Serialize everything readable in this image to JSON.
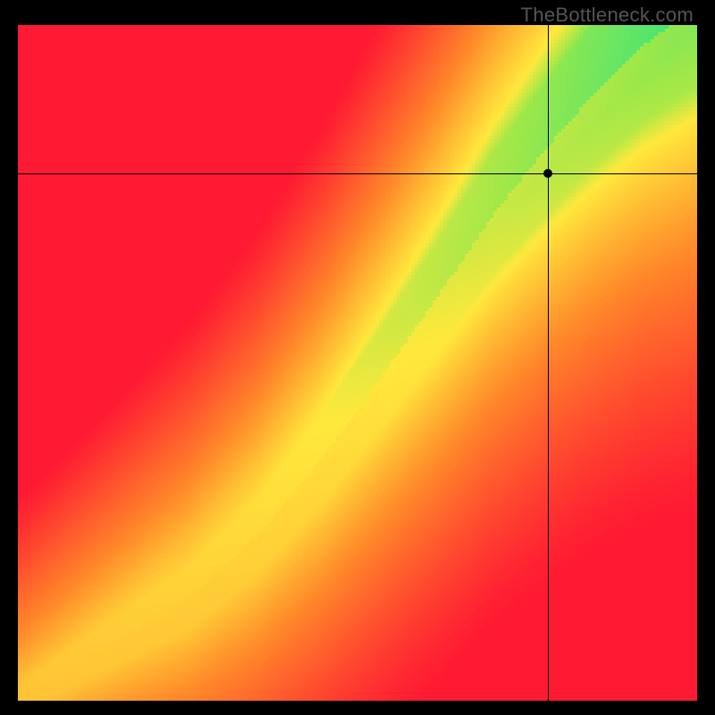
{
  "watermark": "TheBottleneck.com",
  "chart_data": {
    "type": "heatmap",
    "title": "",
    "xlabel": "",
    "ylabel": "",
    "xlim": [
      0,
      100
    ],
    "ylim": [
      0,
      100
    ],
    "crosshair": {
      "x": 78,
      "y": 78
    },
    "marker": {
      "x": 78,
      "y": 78
    },
    "ridge_curve_xy": [
      [
        0,
        0
      ],
      [
        15,
        9
      ],
      [
        25,
        15
      ],
      [
        35,
        24
      ],
      [
        45,
        36
      ],
      [
        55,
        50
      ],
      [
        62,
        60
      ],
      [
        70,
        72
      ],
      [
        78,
        82
      ],
      [
        85,
        90
      ],
      [
        92,
        97
      ],
      [
        100,
        103
      ]
    ],
    "color_scale": {
      "low": "#ff1a33",
      "mid_low": "#ff8a2a",
      "mid": "#ffe93d",
      "mid_high": "#9de84a",
      "high": "#13e38e"
    },
    "grid": false,
    "legend": null,
    "description": "2D heatmap with a green optimal ridge running diagonally from bottom-left to top-right; colors fade through yellow and orange to red away from the ridge. Black crosshair and dot mark a point in the upper-right region on the ridge."
  }
}
